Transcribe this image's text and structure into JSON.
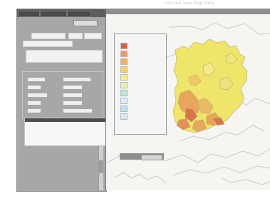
{
  "top_caption": "colored area map view",
  "left_panel": {
    "tabs": [
      "",
      "",
      ""
    ],
    "rows": [
      "",
      "",
      "",
      "",
      "",
      "",
      ""
    ],
    "group_labels": [
      "",
      "",
      "",
      "",
      ""
    ],
    "group_values": [
      "",
      "",
      "",
      "",
      ""
    ],
    "list_header": ""
  },
  "legend": {
    "items": [
      {
        "color": "#d95e4a",
        "label": ""
      },
      {
        "color": "#ec9861",
        "label": ""
      },
      {
        "color": "#f0b25d",
        "label": ""
      },
      {
        "color": "#f6d26b",
        "label": ""
      },
      {
        "color": "#f8e98e",
        "label": ""
      },
      {
        "color": "#e6f0b0",
        "label": ""
      },
      {
        "color": "#bfe5d5",
        "label": ""
      },
      {
        "color": "#d7edf4",
        "label": ""
      },
      {
        "color": "#bcdff3",
        "label": ""
      },
      {
        "color": "#d6e7f6",
        "label": ""
      }
    ],
    "button_label": ""
  },
  "colors": {
    "panel_bg": "#a7a7a7",
    "map_bg": "#f6f5f2",
    "region_yellow": "#efe56a",
    "region_orange": "#e8a55b",
    "region_red": "#d8744b"
  }
}
